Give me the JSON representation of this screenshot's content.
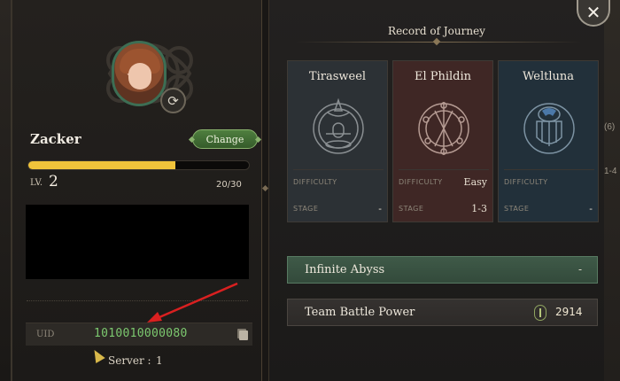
{
  "profile": {
    "name": "Zacker",
    "change_label": "Change",
    "level_label": "LV.",
    "level": "2",
    "xp_text": "20/30",
    "xp_progress": 0.667,
    "uid_label": "UID",
    "uid_value": "1010010000080",
    "server_label": "Server :",
    "server_value": "1"
  },
  "journey": {
    "title": "Record of Journey",
    "difficulty_label": "DIFFICULTY",
    "stage_label": "STAGE",
    "cards": [
      {
        "name": "Tirasweel",
        "difficulty": "",
        "stage": "-",
        "bg": "#2c3135"
      },
      {
        "name": "El Phildin",
        "difficulty": "Easy",
        "stage": "1-3",
        "bg": "#3f2725"
      },
      {
        "name": "Weltluna",
        "difficulty": "",
        "stage": "-",
        "bg": "#22303a"
      }
    ]
  },
  "abyss": {
    "label": "Infinite Abyss",
    "value": "-"
  },
  "power": {
    "label": "Team Battle Power",
    "value": "2914"
  },
  "side_glimpse": [
    "(6)",
    "1-4"
  ],
  "icons": {
    "close": "close-icon",
    "swap": "swap-icon",
    "copy": "copy-icon",
    "power": "battle-power-icon"
  },
  "colors": {
    "uid": "#7cc86f",
    "xp_fill": "#f0c33b",
    "change_button": "#4f7f3f",
    "abyss_row": "#3f5a48",
    "annotation_arrow": "#d92020"
  }
}
